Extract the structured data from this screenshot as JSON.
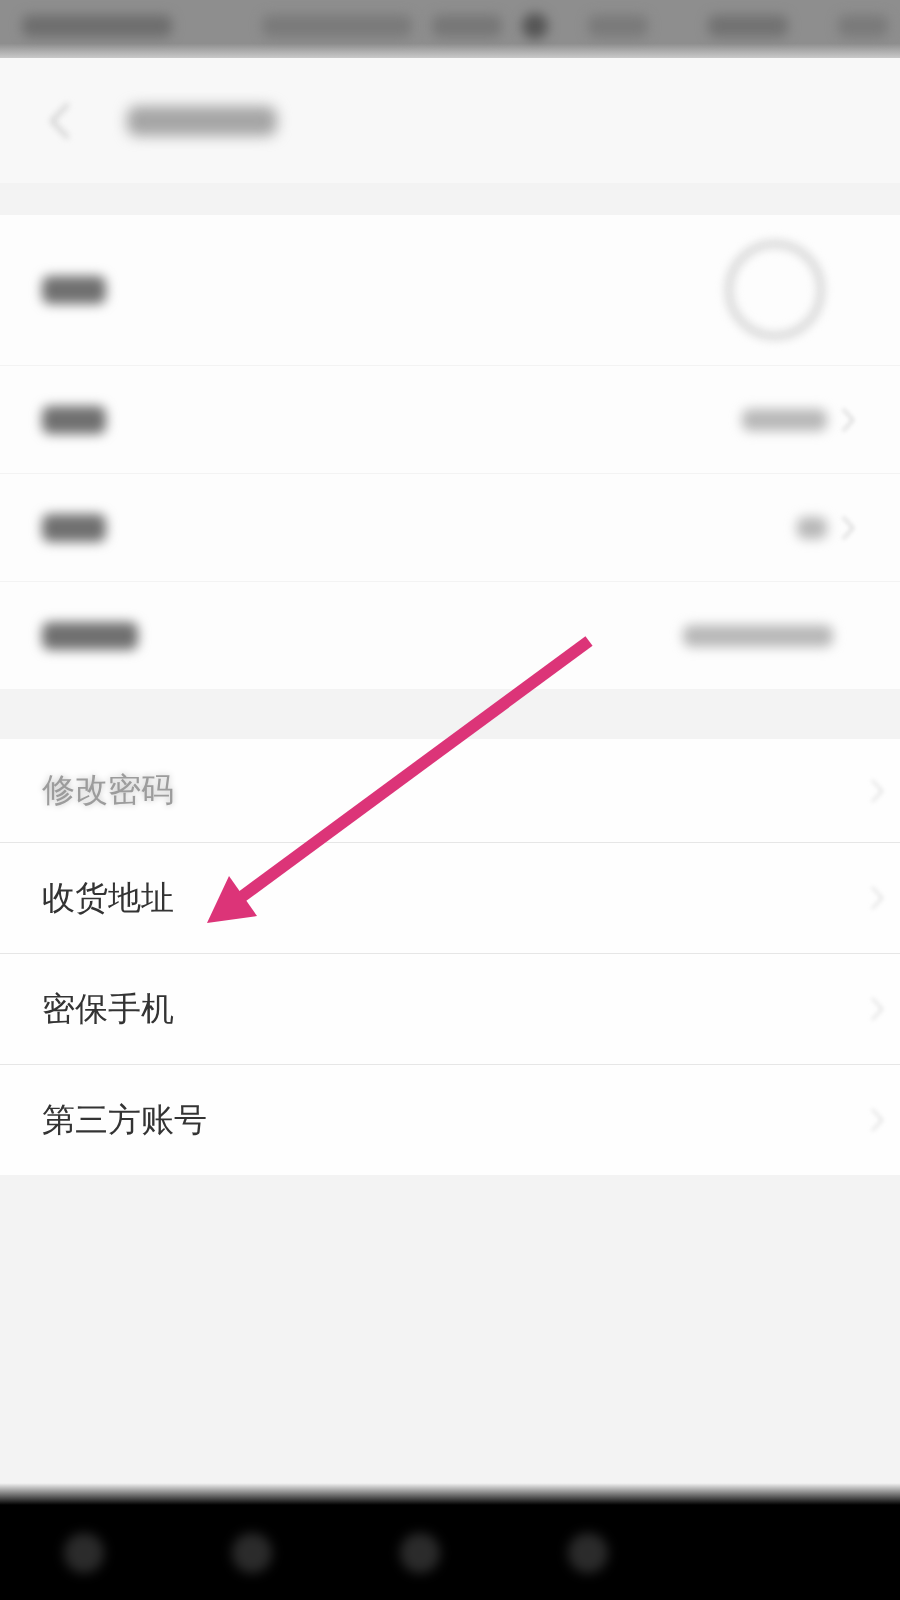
{
  "profile_rows": [
    {
      "kind": "avatar"
    },
    {
      "kind": "value"
    },
    {
      "kind": "short_value"
    },
    {
      "kind": "long_value"
    }
  ],
  "security_rows": [
    {
      "label": "修改密码",
      "dimmed": true
    },
    {
      "label": "收货地址",
      "dimmed": false
    },
    {
      "label": "密保手机",
      "dimmed": false
    },
    {
      "label": "第三方账号",
      "dimmed": false
    }
  ]
}
